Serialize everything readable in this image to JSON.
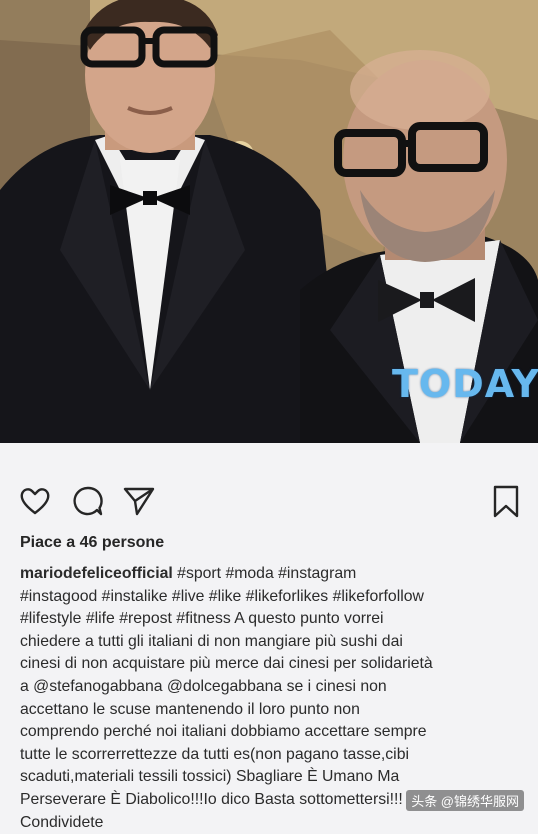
{
  "post": {
    "photo_watermark": "TODAY",
    "likes_text": "Piace a 46 persone",
    "username": "mariodefeliceofficial",
    "caption_body": " #sport #moda #instagram\n#instagood #instalike #live #like #likeforlikes #likeforfollow\n#lifestyle #life #repost #fitness A questo punto vorrei\nchiedere a tutti gli italiani di non mangiare più sushi dai\ncinesi di non acquistare più merce dai cinesi per solidarietà\na @stefanogabbana @dolcegabbana se i cinesi non\naccettano le scuse mantenendo il loro punto non\ncomprendo perché noi italiani dobbiamo accettare sempre\ntutte le scorrerrettezze da tutti es(non pagano tasse,cibi\nscaduti,materiali tessili tossici) Sbagliare È Umano Ma\nPerseverare È Diabolico!!!Io dico Basta sottomettersi!!!\nCondividete"
  },
  "actions": {
    "like_icon": "heart-outline-icon",
    "comment_icon": "comment-bubble-icon",
    "share_icon": "paper-plane-icon",
    "save_icon": "bookmark-outline-icon"
  },
  "footer_watermark": "头条 @锦绣华服网",
  "colors": {
    "text": "#262626",
    "background": "#f3f3f5",
    "watermark_blue": "#67b8ee"
  }
}
